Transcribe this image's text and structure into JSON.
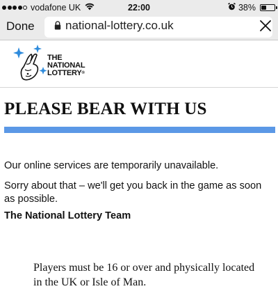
{
  "status_bar": {
    "carrier": "vodafone UK",
    "time": "22:00",
    "battery": "38%",
    "battery_level": 0.38,
    "signal_bars_filled": 4,
    "signal_bars_total": 5
  },
  "browser": {
    "done_label": "Done",
    "url": "national-lottery.co.uk"
  },
  "logo": {
    "line1": "THE",
    "line2": "NATIONAL",
    "line3": "LOTTERY"
  },
  "page": {
    "title": "PLEASE BEAR WITH US",
    "message_1": "Our online services are temporarily unavailable.",
    "message_2": "Sorry about that – we'll get you back in the game as soon as possible.",
    "team": "The National Lottery Team",
    "footer": "Players must be 16 or over and physically located in the UK or Isle of Man."
  },
  "colors": {
    "accent_bar": "#5b98e6",
    "logo_blue": "#2e8bdc"
  }
}
